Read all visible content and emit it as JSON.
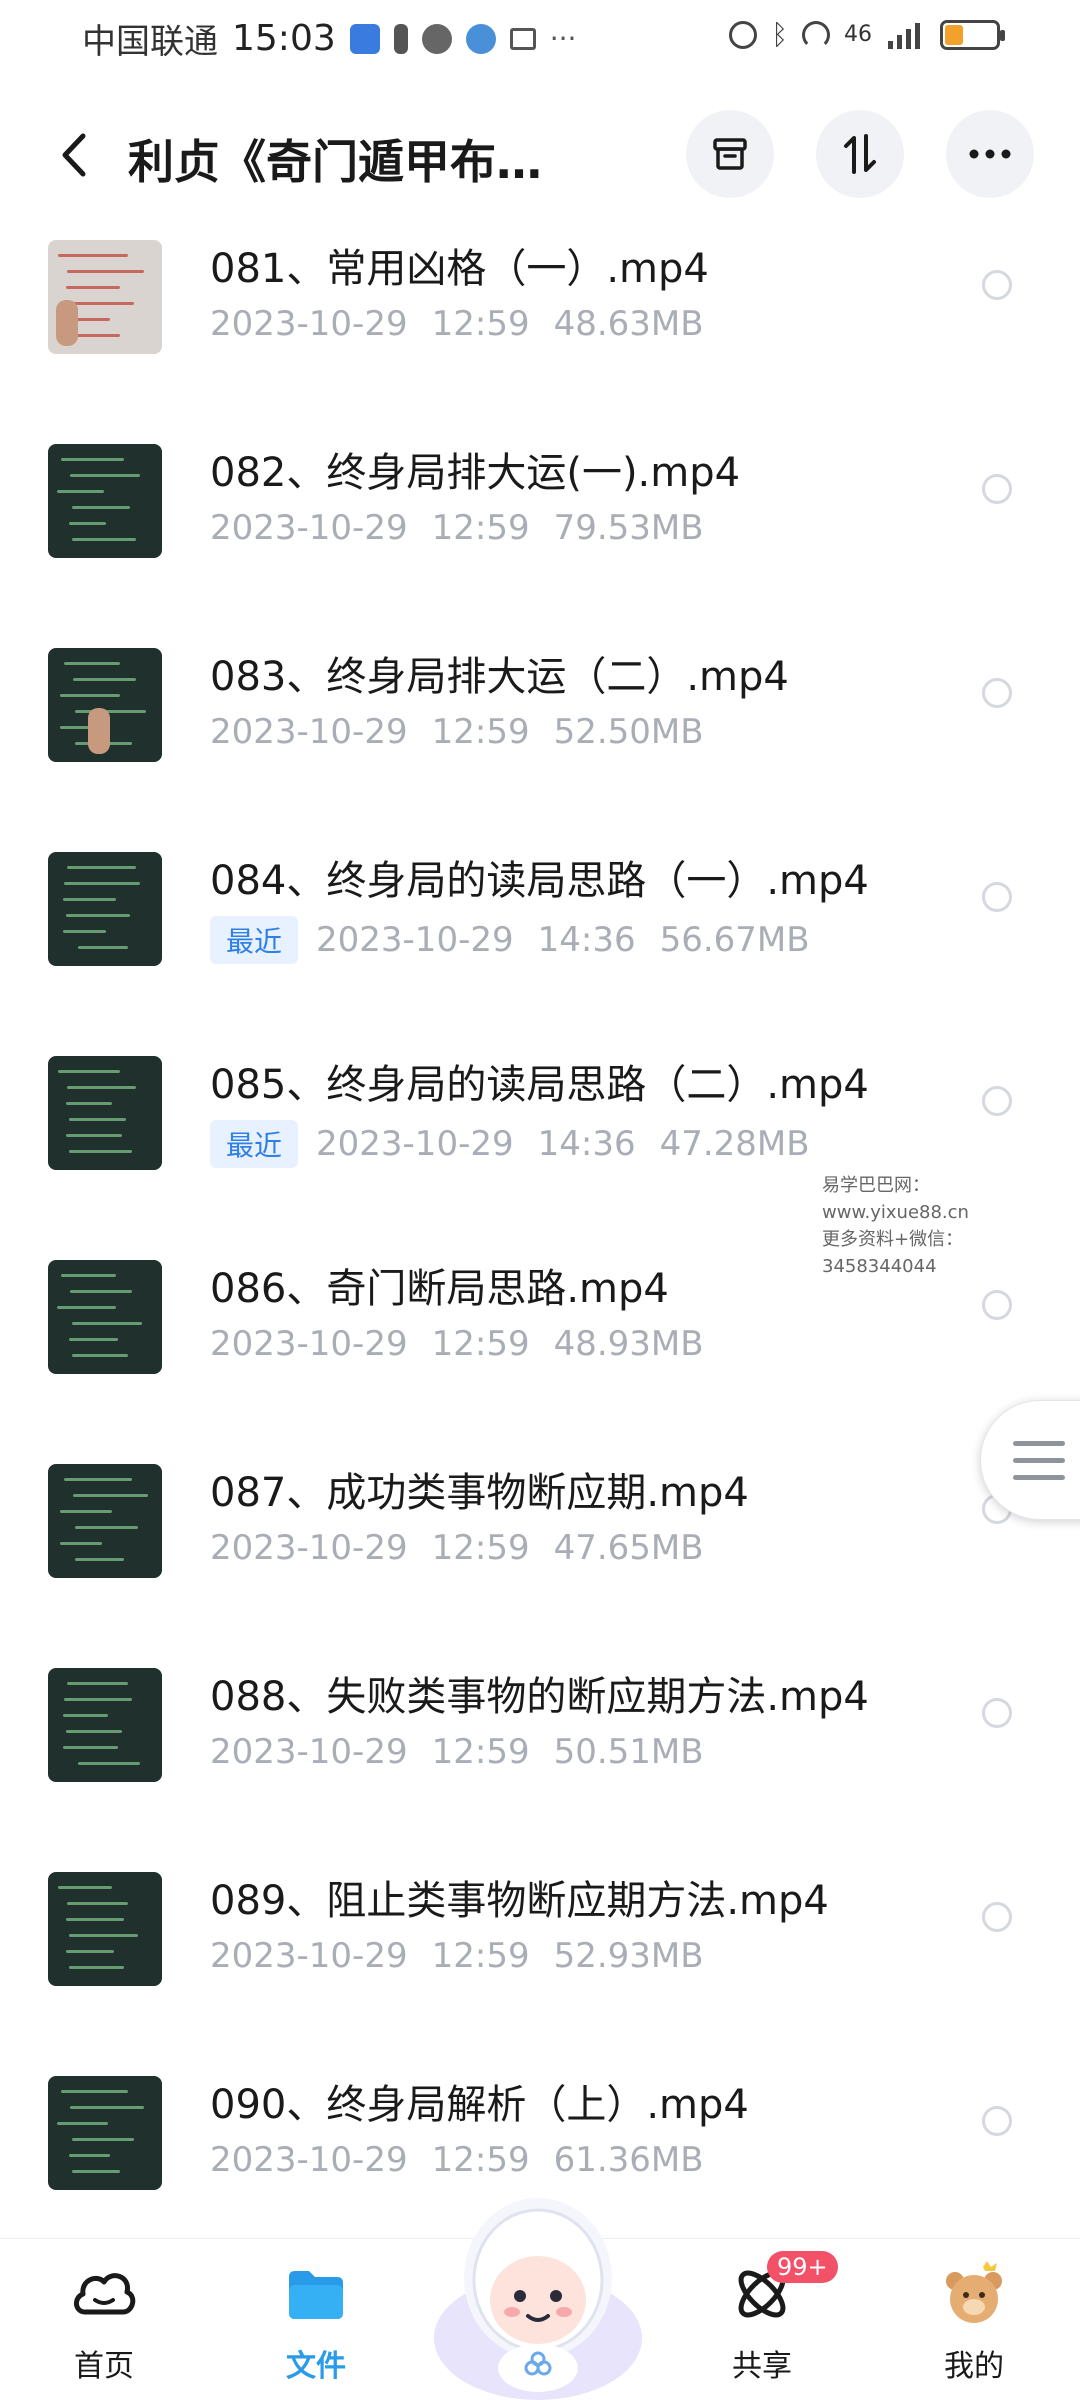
{
  "status_bar": {
    "carrier": "中国联通",
    "time": "15:03",
    "signal_text": "46"
  },
  "header": {
    "title": "利贞《奇门遁甲布…"
  },
  "files": [
    {
      "name": "081、常用凶格（一）.mp4",
      "tag": "",
      "date": "2023-10-29",
      "time": "12:59",
      "size": "48.63MB",
      "thumb": "white"
    },
    {
      "name": "082、终身局排大运(一).mp4",
      "tag": "",
      "date": "2023-10-29",
      "time": "12:59",
      "size": "79.53MB",
      "thumb": "dark"
    },
    {
      "name": "083、终身局排大运（二）.mp4",
      "tag": "",
      "date": "2023-10-29",
      "time": "12:59",
      "size": "52.50MB",
      "thumb": "dark"
    },
    {
      "name": "084、终身局的读局思路（一）.mp4",
      "tag": "最近",
      "date": "2023-10-29",
      "time": "14:36",
      "size": "56.67MB",
      "thumb": "dark"
    },
    {
      "name": "085、终身局的读局思路（二）.mp4",
      "tag": "最近",
      "date": "2023-10-29",
      "time": "14:36",
      "size": "47.28MB",
      "thumb": "dark"
    },
    {
      "name": "086、奇门断局思路.mp4",
      "tag": "",
      "date": "2023-10-29",
      "time": "12:59",
      "size": "48.93MB",
      "thumb": "dark"
    },
    {
      "name": "087、成功类事物断应期.mp4",
      "tag": "",
      "date": "2023-10-29",
      "time": "12:59",
      "size": "47.65MB",
      "thumb": "dark"
    },
    {
      "name": "088、失败类事物的断应期方法.mp4",
      "tag": "",
      "date": "2023-10-29",
      "time": "12:59",
      "size": "50.51MB",
      "thumb": "dark"
    },
    {
      "name": "089、阻止类事物断应期方法.mp4",
      "tag": "",
      "date": "2023-10-29",
      "time": "12:59",
      "size": "52.93MB",
      "thumb": "dark"
    },
    {
      "name": "090、终身局解析（上）.mp4",
      "tag": "",
      "date": "2023-10-29",
      "time": "12:59",
      "size": "61.36MB",
      "thumb": "dark"
    }
  ],
  "watermark": {
    "line1": "易学巴巴网：www.yixue88.cn",
    "line2": "更多资料+微信：3458344044"
  },
  "bottom_nav": {
    "items": [
      {
        "label": "首页",
        "icon": "cloud-icon",
        "active": false
      },
      {
        "label": "文件",
        "icon": "folder-icon",
        "active": true
      },
      {
        "label": "共享",
        "icon": "share-orbit-icon",
        "active": false,
        "badge": "99+"
      },
      {
        "label": "我的",
        "icon": "bear-avatar-icon",
        "active": false
      }
    ]
  },
  "colors": {
    "accent": "#2a9be8",
    "tag_text": "#2f7fe6",
    "tag_bg": "#e8f1ff",
    "meta_text": "#a9adb5",
    "badge": "#f25168",
    "battery": "#f2a22c"
  }
}
